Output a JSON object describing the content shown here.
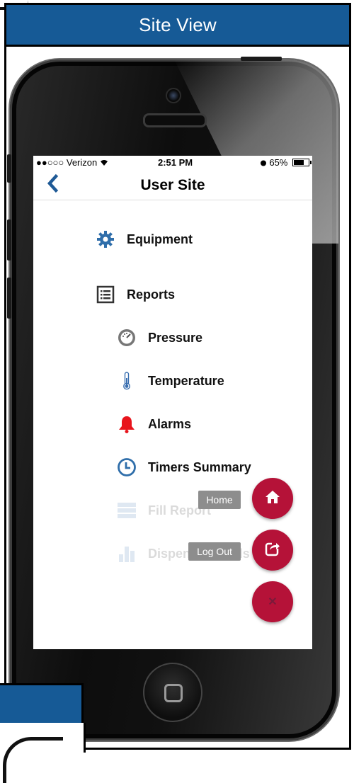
{
  "header": {
    "title": "Site View"
  },
  "status_bar": {
    "carrier": "●●○○○ Verizon",
    "time": "2:51 PM",
    "battery": "65%"
  },
  "nav": {
    "title": "User Site"
  },
  "menu": {
    "equipment": "Equipment",
    "reports": "Reports",
    "pressure": "Pressure",
    "temperature": "Temperature",
    "alarms": "Alarms",
    "timers_summary": "Timers Summary",
    "fill_report": "Fill Report",
    "dispenser_totals": "Dispenser Totals"
  },
  "fab": {
    "home_label": "Home",
    "logout_label": "Log Out"
  },
  "colors": {
    "header_blue": "#165a96",
    "accent_blue": "#2f6eaa",
    "fab_red": "#b51238",
    "alarm_red": "#e8141c"
  },
  "icons": [
    "chevron-left-icon",
    "gear-icon",
    "report-list-icon",
    "gauge-icon",
    "thermometer-icon",
    "bell-icon",
    "clock-icon",
    "server-icon",
    "bar-chart-icon",
    "home-icon",
    "share-icon",
    "close-icon"
  ]
}
